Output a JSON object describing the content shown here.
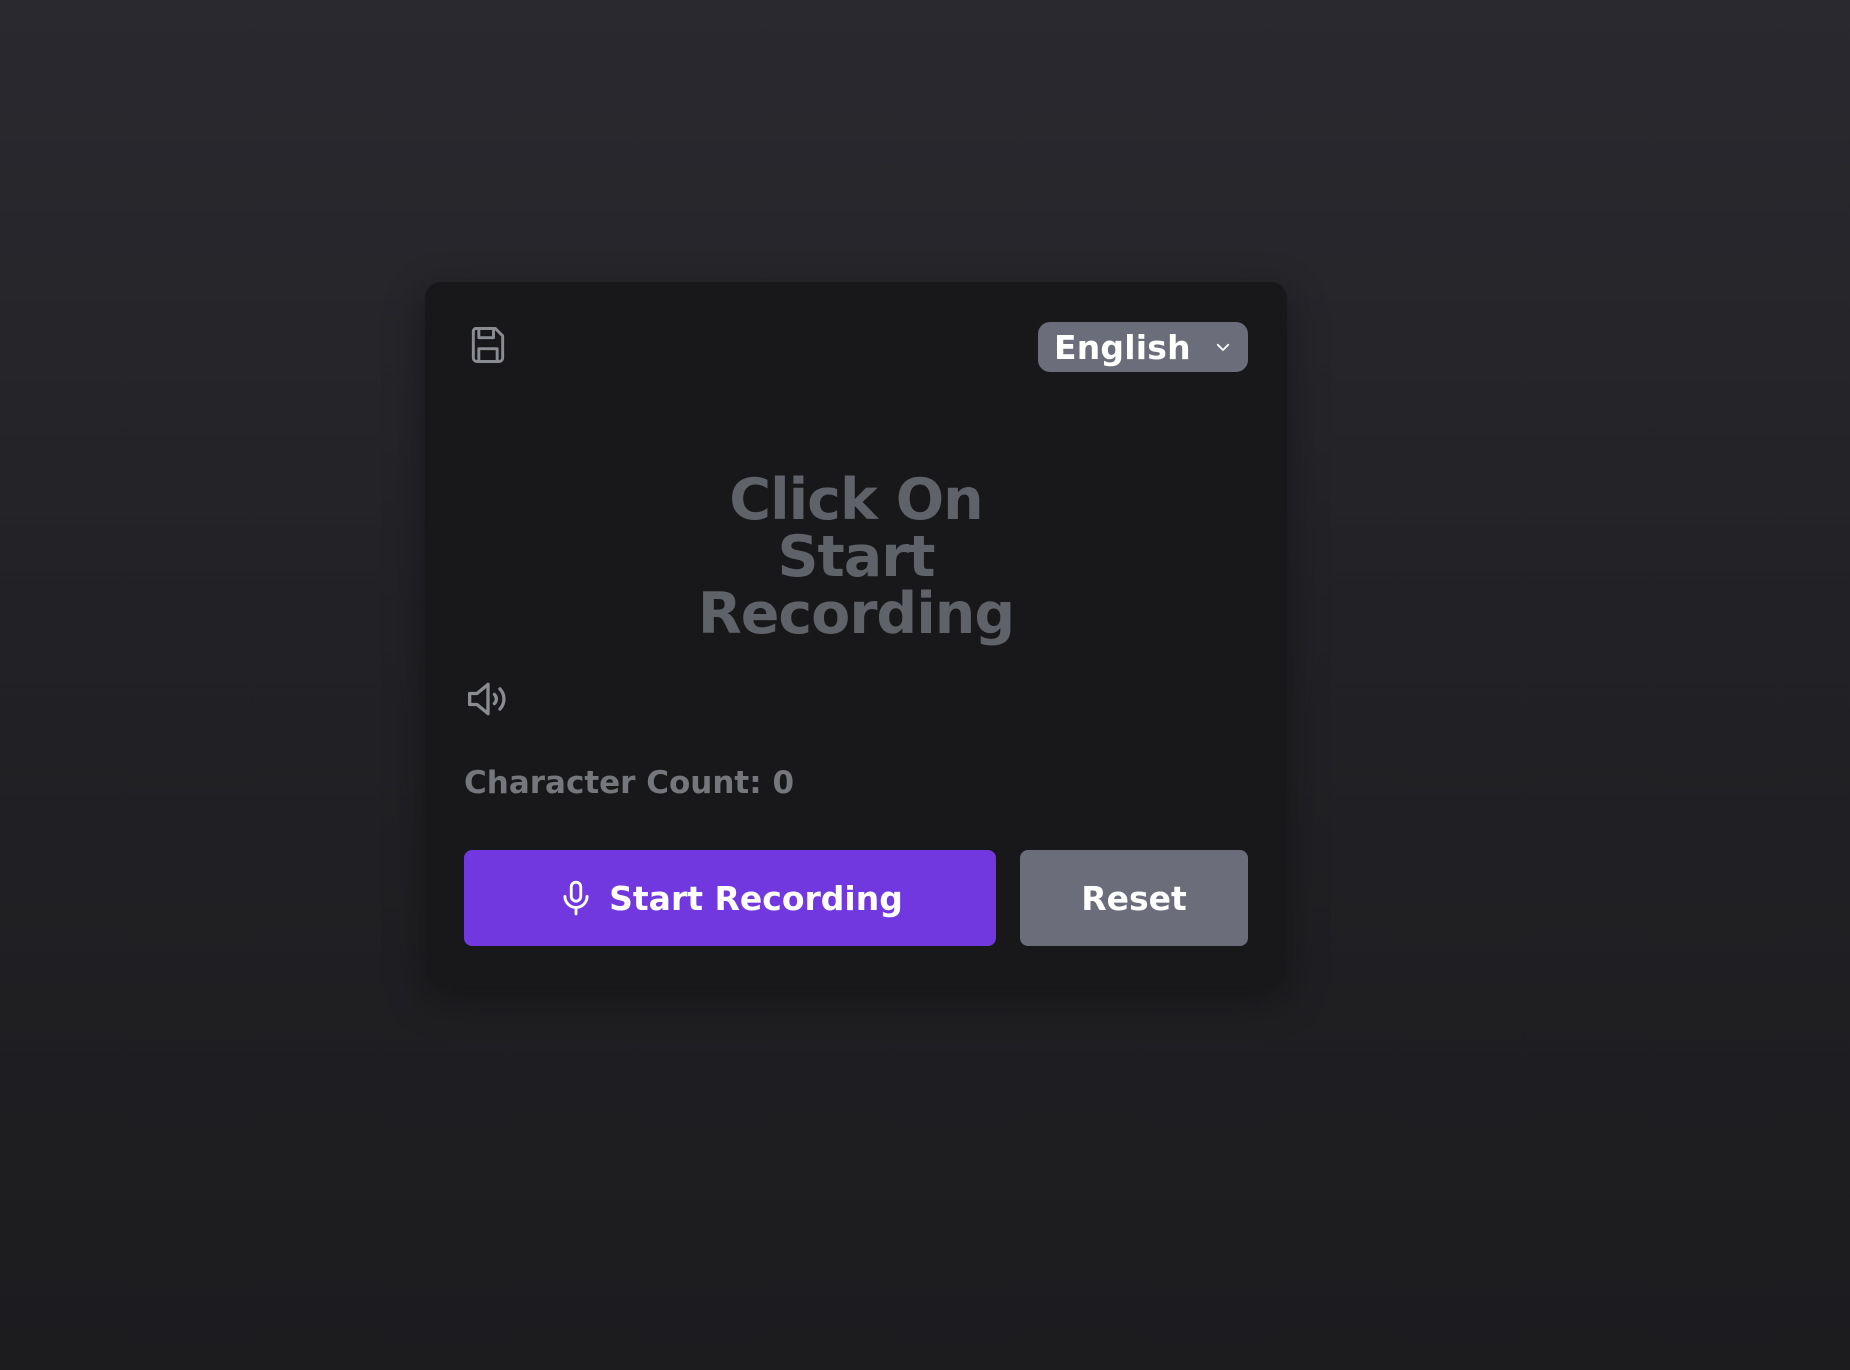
{
  "language_select": {
    "selected": "English"
  },
  "transcript": {
    "placeholder_lines": [
      "Click On",
      "Start",
      "Recording"
    ]
  },
  "stats": {
    "character_count_label": "Character Count: 0"
  },
  "actions": {
    "start_label": "Start Recording",
    "reset_label": "Reset"
  },
  "icons": {
    "save": "save-icon",
    "speaker": "speaker-icon",
    "mic": "microphone-icon",
    "chevron": "chevron-down-icon"
  },
  "colors": {
    "primary": "#7138e0",
    "secondary": "#6b6e7a",
    "card": "#18181a"
  }
}
